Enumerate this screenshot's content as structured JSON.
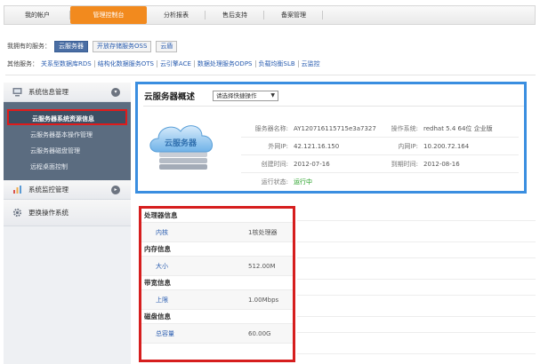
{
  "topnav": {
    "items": [
      "我的帐户",
      "管理控制台",
      "分析报表",
      "售后支持",
      "备案管理"
    ],
    "active_index": 1
  },
  "services": {
    "label": "我拥有的服务：",
    "buttons": [
      "云服务器",
      "开放存储服务OSS",
      "云盾"
    ],
    "active_index": 0
  },
  "other_services": {
    "label": "其他服务：",
    "links": [
      "关系型数据库RDS",
      "结构化数据服务OTS",
      "云引擎ACE",
      "数据处理服务ODPS",
      "负载均衡SLB",
      "云监控"
    ]
  },
  "sidebar": {
    "group1": {
      "label": "系统信息管理"
    },
    "sub_items": [
      "云服务器系统资源信息",
      "云服务器基本操作管理",
      "云服务器磁盘管理",
      "远程桌面控制"
    ],
    "active_sub_index": 0,
    "group2": {
      "label": "系统监控管理"
    },
    "group3": {
      "label": "更换操作系统"
    }
  },
  "overview": {
    "title": "云服务器概述",
    "select_value": "请选择快捷操作",
    "cloud_text": "云服务器",
    "fields": {
      "name_label": "服务器名称:",
      "name_value": "AY120716115715e3a7327",
      "os_label": "操作系统:",
      "os_value": "redhat 5.4 64位 企业版",
      "public_ip_label": "外网IP:",
      "public_ip_value": "42.121.16.150",
      "private_ip_label": "内网IP:",
      "private_ip_value": "10.200.72.164",
      "created_label": "创建时间:",
      "created_value": "2012-07-16",
      "expire_label": "到期时间:",
      "expire_value": "2012-08-16",
      "status_label": "运行状态:",
      "status_value": "运行中"
    }
  },
  "details": {
    "cpu": {
      "title": "处理器信息",
      "key": "内核",
      "value": "1核处理器"
    },
    "memory": {
      "title": "内存信息",
      "key": "大小",
      "value": "512.00M"
    },
    "bandwidth": {
      "title": "带宽信息",
      "key": "上限",
      "value": "1.00Mbps"
    },
    "disk": {
      "title": "磁盘信息",
      "key": "总容量",
      "value": "60.00G"
    }
  },
  "colors": {
    "accent_orange": "#f28a1e",
    "highlight_red": "#d61e1e",
    "highlight_blue": "#3a8ee0",
    "status_green": "#1e9d1e"
  }
}
